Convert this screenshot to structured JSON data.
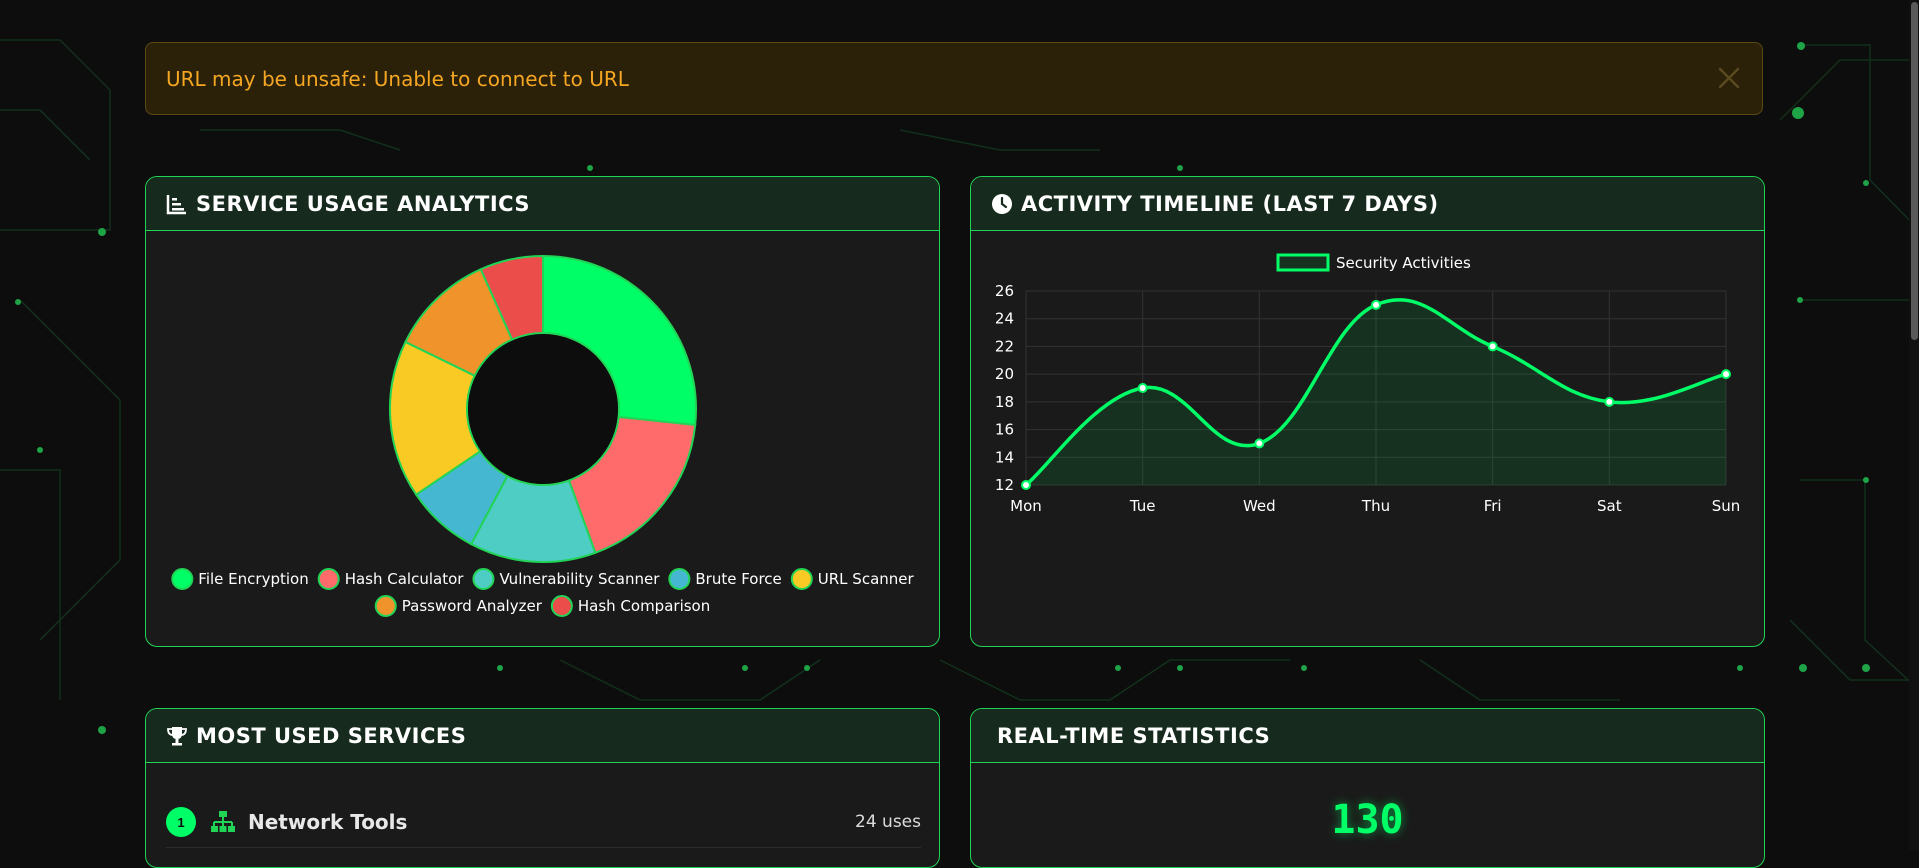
{
  "alert": {
    "message": "URL may be unsafe: Unable to connect to URL",
    "close_icon": "close-icon"
  },
  "usage_card": {
    "title": "Service Usage Analytics",
    "icon": "chart-bar-icon"
  },
  "timeline_card": {
    "title": "Activity Timeline (Last 7 Days)",
    "icon": "clock-icon"
  },
  "most_used_card": {
    "title": "Most Used Services",
    "icon": "trophy-icon",
    "items": [
      {
        "rank": "1",
        "name": "Network Tools",
        "uses": "24 uses",
        "icon": "network-icon"
      }
    ]
  },
  "stats_card": {
    "title": "Real-Time Statistics",
    "value": "130"
  },
  "colors": {
    "accent": "#00ff66",
    "alert_text": "#f5a623",
    "card_border": "#22d455"
  },
  "chart_data": [
    {
      "type": "pie",
      "variant": "doughnut",
      "categories": [
        "File Encryption",
        "Hash Calculator",
        "Vulnerability Scanner",
        "Brute Force",
        "URL Scanner",
        "Password Analyzer",
        "Hash Comparison"
      ],
      "values": [
        24,
        16,
        12,
        7,
        15,
        10,
        6
      ],
      "colors": [
        "#00ff66",
        "#ff6b6b",
        "#4ecdc4",
        "#45b7d1",
        "#f9ca24",
        "#f0932b",
        "#eb4d4b"
      ],
      "legend_position": "bottom"
    },
    {
      "type": "line",
      "categories": [
        "Mon",
        "Tue",
        "Wed",
        "Thu",
        "Fri",
        "Sat",
        "Sun"
      ],
      "series": [
        {
          "name": "Security Activities",
          "values": [
            12,
            19,
            15,
            25,
            22,
            18,
            20
          ],
          "color": "#00ff66"
        }
      ],
      "ylim": [
        12,
        26
      ],
      "yticks": [
        12,
        14,
        16,
        18,
        20,
        22,
        24,
        26
      ],
      "grid": true,
      "legend_position": "top"
    }
  ]
}
